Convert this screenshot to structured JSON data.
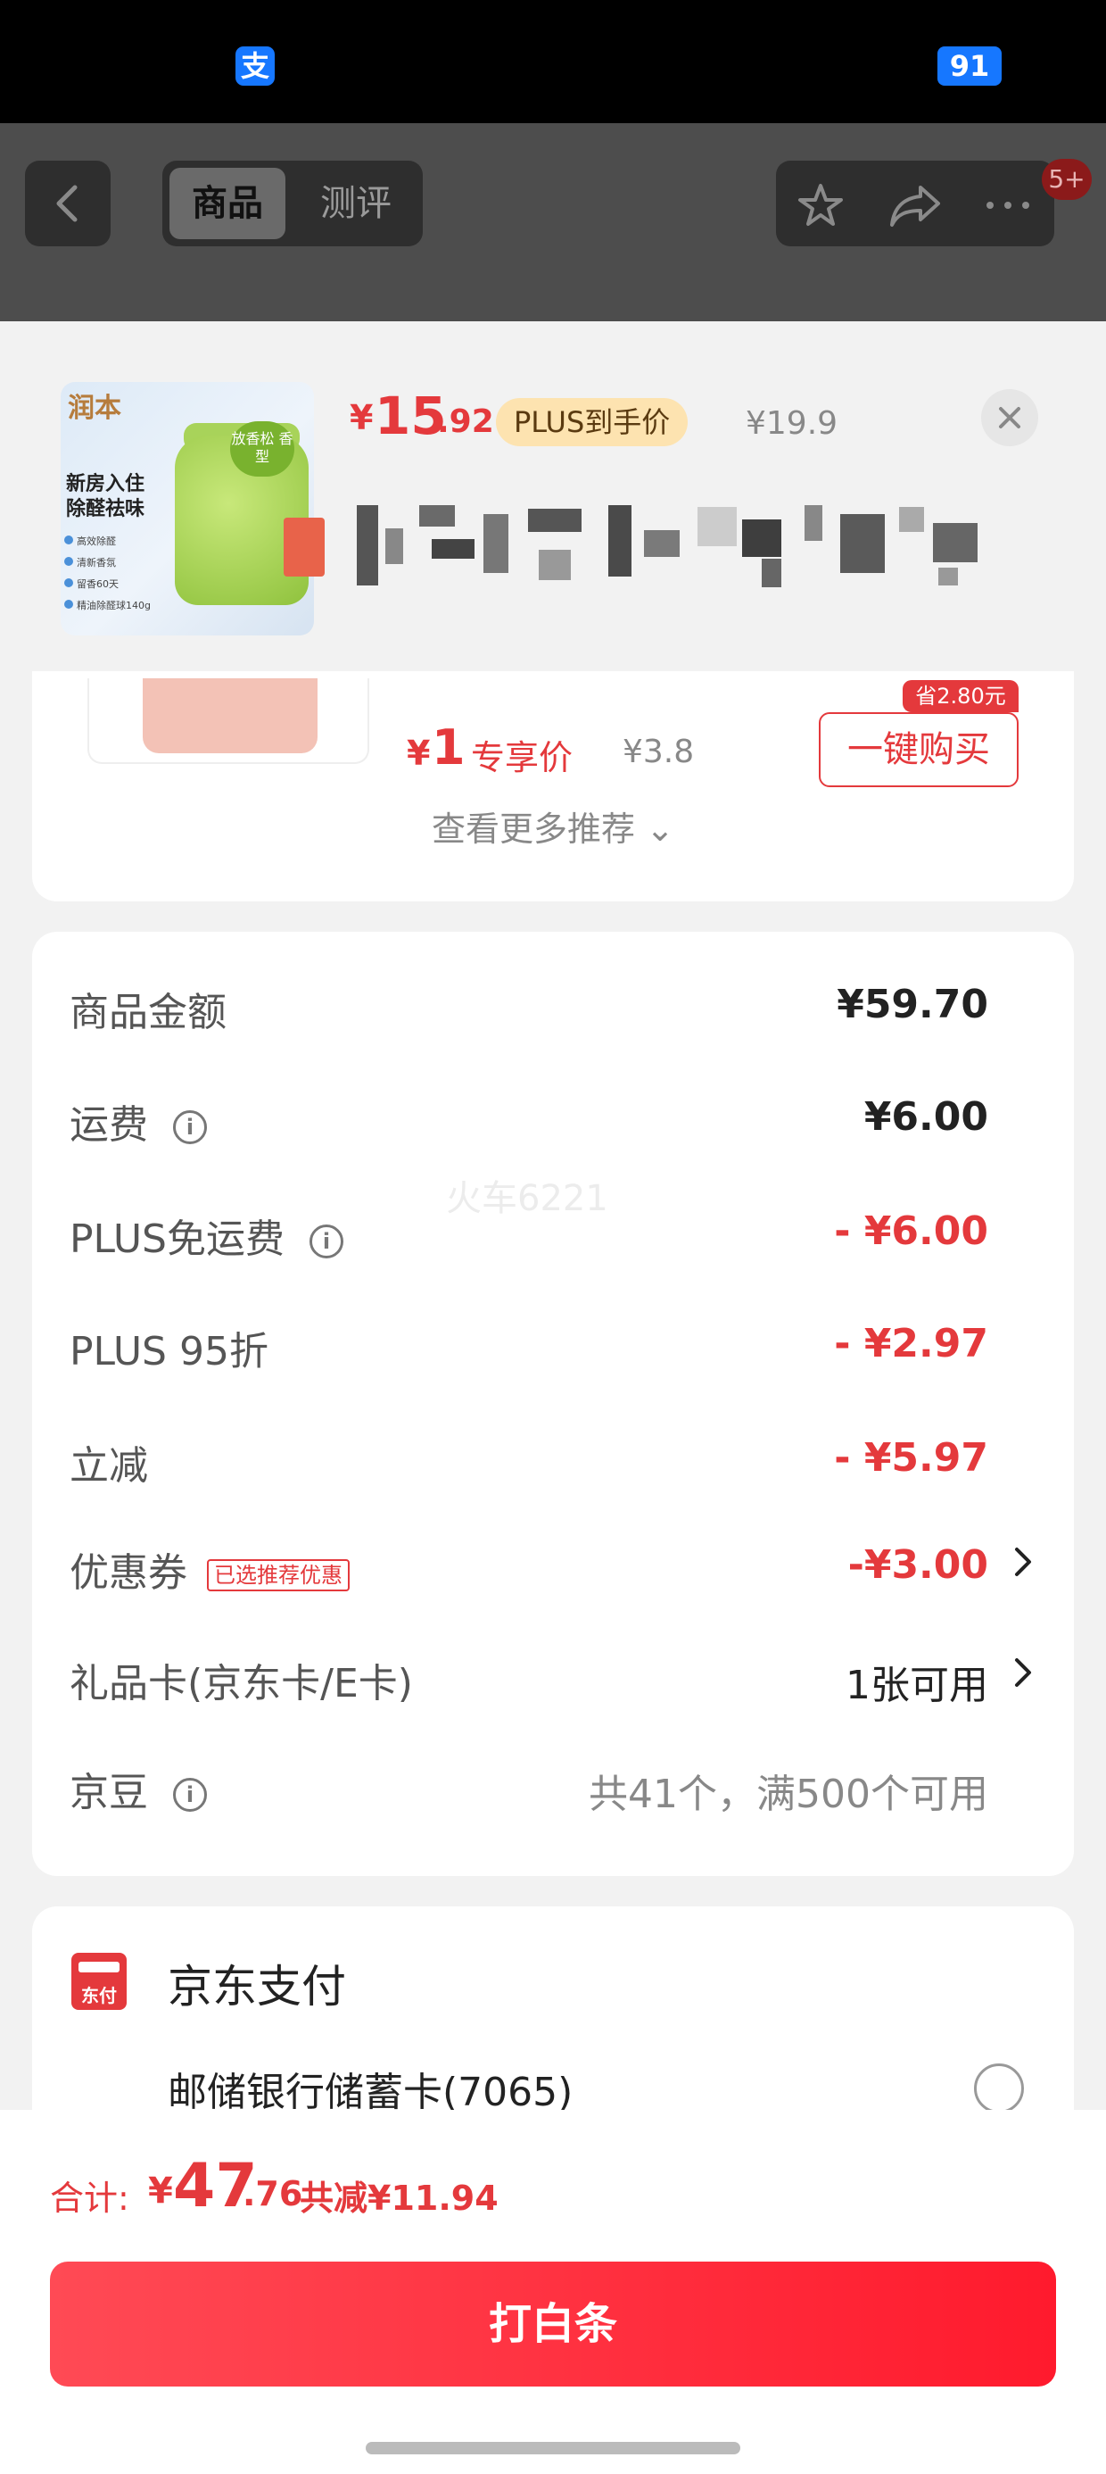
{
  "status_bar": {
    "badge": "91",
    "alipay_glyph": "支"
  },
  "nav": {
    "tabs": [
      {
        "label": "商品"
      },
      {
        "label": "测评"
      }
    ],
    "badge": "5+",
    "icons": [
      "back-icon",
      "star-icon",
      "share-icon",
      "more-icon"
    ]
  },
  "product": {
    "price_symbol": "¥",
    "price_int": "15",
    "price_dec": ".92",
    "plus_tag": "PLUS到手价",
    "orig_price": "¥19.9",
    "image_text": {
      "brand": "润本",
      "line1": "新房入住",
      "line2": "除醛祛味",
      "tag": "放香松 香型",
      "bullets": [
        "高效除醛",
        "清新香氛",
        "留香60天",
        "精油除醛球140g"
      ]
    }
  },
  "recommendation": {
    "price_symbol": "¥",
    "price": "1",
    "label": "专享价",
    "orig_price": "¥3.8",
    "buy_label": "一键购买",
    "buy_tag": "省2.80元",
    "more_label": "查看更多推荐 ⌄"
  },
  "costs": {
    "rows": [
      {
        "label": "商品金额",
        "value": "¥59.70"
      },
      {
        "label": "运费",
        "value": "¥6.00"
      },
      {
        "label": "PLUS免运费",
        "value": "- ¥6.00"
      },
      {
        "label": "PLUS 95折",
        "value": "- ¥2.97"
      },
      {
        "label": "立减",
        "value": "- ¥5.97"
      },
      {
        "label": "优惠券",
        "value": "-¥3.00",
        "tag": "已选推荐优惠"
      },
      {
        "label": "礼品卡(京东卡/E卡)",
        "value": "1张可用"
      },
      {
        "label": "京豆",
        "value": "共41个，满500个可用"
      }
    ],
    "info_glyph": "i"
  },
  "payment": {
    "icon_text": "东付",
    "title": "京东支付",
    "bank": "邮储银行储蓄卡(7065)"
  },
  "bottom": {
    "total_label": "合计:",
    "total_symbol": "¥",
    "total_int": "47",
    "total_dec": ".76",
    "saved": "共减¥11.94",
    "pay_button": "打白条"
  },
  "watermark": "火车6221",
  "colors": {
    "accent_red": "#e4393c",
    "alipay_blue": "#1677ff",
    "plus_gold": "#fde3b0"
  }
}
